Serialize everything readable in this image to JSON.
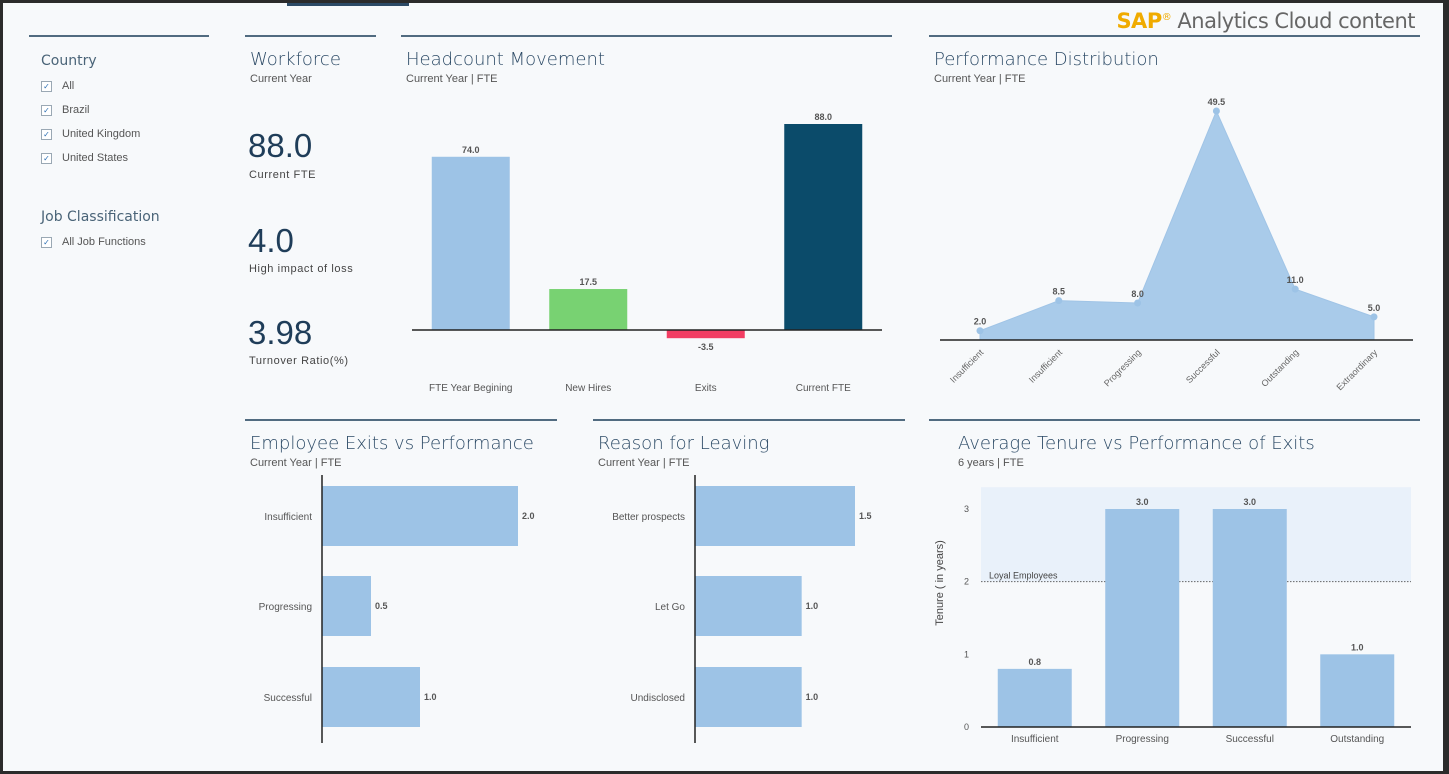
{
  "brand": {
    "sap": "SAP",
    "reg": "®",
    "rest": " Analytics Cloud content"
  },
  "filters": {
    "country": {
      "title": "Country",
      "items": [
        {
          "label": "All",
          "checked": true
        },
        {
          "label": "Brazil",
          "checked": true
        },
        {
          "label": "United Kingdom",
          "checked": true
        },
        {
          "label": "United States",
          "checked": true
        }
      ]
    },
    "job": {
      "title": "Job Classification",
      "items": [
        {
          "label": "All Job Functions",
          "checked": true
        }
      ]
    },
    "check_glyph": "✓"
  },
  "workforce": {
    "title": "Workforce",
    "subtitle": "Current Year",
    "kpis": [
      {
        "value": "88.0",
        "label": "Current FTE"
      },
      {
        "value": "4.0",
        "label": "High impact of loss"
      },
      {
        "value": "3.98",
        "label": "Turnover Ratio(%)"
      }
    ]
  },
  "panels": {
    "headcount": {
      "title": "Headcount Movement",
      "subtitle": "Current Year | FTE"
    },
    "performance": {
      "title": "Performance Distribution",
      "subtitle": "Current Year | FTE"
    },
    "exits": {
      "title": "Employee Exits vs Performance",
      "subtitle": "Current Year | FTE"
    },
    "reason": {
      "title": "Reason for Leaving",
      "subtitle": "Current Year | FTE"
    },
    "tenure": {
      "title": "Average Tenure vs Performance of Exits",
      "subtitle": "6 years | FTE"
    }
  },
  "chart_data": [
    {
      "id": "headcount",
      "type": "bar",
      "title": "Headcount Movement",
      "categories": [
        "FTE Year Begining",
        "New Hires",
        "Exits",
        "Current FTE"
      ],
      "values": [
        74.0,
        17.5,
        -3.5,
        88.0
      ],
      "labels": [
        "74.0",
        "17.5",
        "-3.5",
        "88.0"
      ],
      "colors": [
        "#9dc3e6",
        "#78d272",
        "#f23d63",
        "#0b4b6a"
      ],
      "ylim": [
        -10,
        95
      ]
    },
    {
      "id": "performance",
      "type": "area",
      "title": "Performance Distribution",
      "categories": [
        "Insufficient",
        "Insufficient",
        "Progressing",
        "Successful",
        "Outstanding",
        "Extraordinary"
      ],
      "values": [
        2.0,
        8.5,
        8.0,
        49.5,
        11.0,
        5.0
      ],
      "labels": [
        "2.0",
        "8.5",
        "8.0",
        "49.5",
        "11.0",
        "5.0"
      ],
      "color": "#a9cbea",
      "ylim": [
        0,
        52
      ]
    },
    {
      "id": "exits",
      "type": "bar",
      "orientation": "horizontal",
      "title": "Employee Exits vs Performance",
      "categories": [
        "Insufficient",
        "Progressing",
        "Successful"
      ],
      "values": [
        2.0,
        0.5,
        1.0
      ],
      "labels": [
        "2.0",
        "0.5",
        "1.0"
      ],
      "color": "#9dc3e6",
      "xlim": [
        0,
        2.0
      ]
    },
    {
      "id": "reason",
      "type": "bar",
      "orientation": "horizontal",
      "title": "Reason for Leaving",
      "categories": [
        "Better prospects",
        "Let Go",
        "Undisclosed"
      ],
      "values": [
        1.5,
        1.0,
        1.0
      ],
      "labels": [
        "1.5",
        "1.0",
        "1.0"
      ],
      "color": "#9dc3e6",
      "xlim": [
        0,
        1.5
      ]
    },
    {
      "id": "tenure",
      "type": "bar",
      "title": "Average Tenure vs Performance of Exits",
      "categories": [
        "Insufficient",
        "Progressing",
        "Successful",
        "Outstanding"
      ],
      "values": [
        0.8,
        3.0,
        3.0,
        1.0
      ],
      "labels": [
        "0.8",
        "3.0",
        "3.0",
        "1.0"
      ],
      "color": "#9dc3e6",
      "ylabel": "Tenure ( in years)",
      "yticks": [
        0,
        1,
        2,
        3
      ],
      "ylim": [
        0,
        3.3
      ],
      "reference_line": {
        "value": 2,
        "label": "Loyal Employees"
      },
      "band": {
        "from": 2,
        "to": 3.3,
        "color": "#e9f1fa"
      }
    }
  ]
}
